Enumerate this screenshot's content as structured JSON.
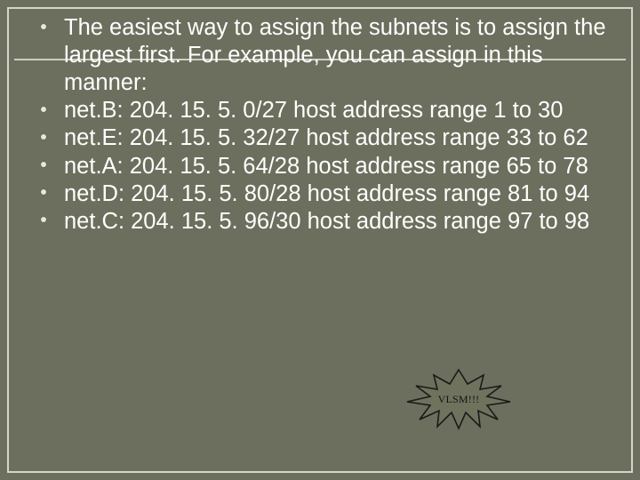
{
  "slide": {
    "bullets": [
      "The easiest way to assign the subnets is to assign the largest first. For example, you can assign in this manner:",
      "net.B: 204. 15. 5. 0/27  host address range 1 to 30",
      "net.E: 204. 15. 5. 32/27 host address range 33 to 62",
      "net.A: 204. 15. 5. 64/28 host address range 65 to 78",
      "net.D: 204. 15. 5. 80/28 host address range 81 to 94",
      "net.C: 204. 15. 5. 96/30 host address range 97 to 98"
    ],
    "burst_label": "VLSM!!!"
  },
  "colors": {
    "background": "#6c6f5d",
    "text": "#ffffff",
    "frame": "#ffffff",
    "burst_fill": "#6f735d",
    "burst_stroke": "#1a1a1a"
  }
}
